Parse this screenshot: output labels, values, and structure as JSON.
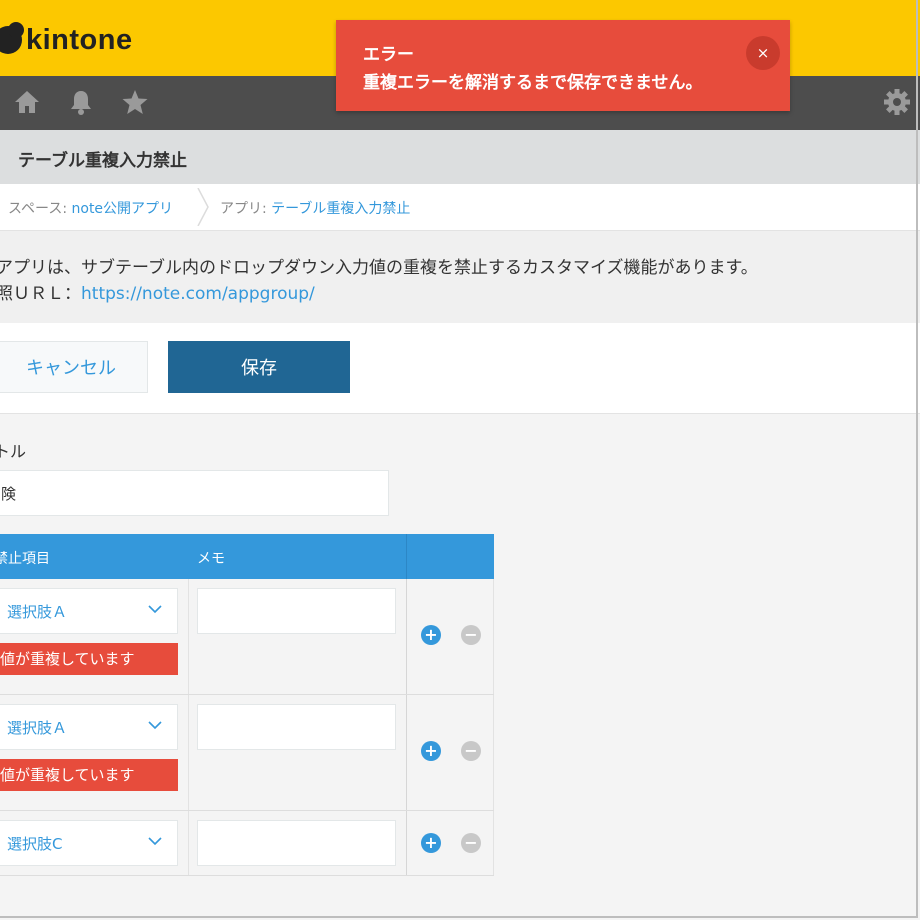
{
  "header": {
    "logo_text": "kintone"
  },
  "nav": {
    "icons": [
      "home-icon",
      "bell-icon",
      "star-icon",
      "gear-icon"
    ]
  },
  "toast": {
    "title": "エラー",
    "message": "重複エラーを解消するまで保存できません。",
    "close_glyph": "×"
  },
  "app": {
    "title": "テーブル重複入力禁止"
  },
  "breadcrumb": {
    "space_label": "スペース: ",
    "space_link": "note公開アプリ",
    "app_label": "アプリ: ",
    "app_link": "テーブル重複入力禁止"
  },
  "description": {
    "line1": "アプリは、サブテーブル内のドロップダウン入力値の重複を禁止するカスタマイズ機能があります。",
    "line2_label": "照ＵＲＬ：",
    "line2_link": "https://note.com/appgroup/"
  },
  "actions": {
    "cancel_label": "キャンセル",
    "save_label": "保存"
  },
  "form": {
    "title_label": "トル",
    "title_value": "険"
  },
  "table": {
    "headers": [
      "禁止項目",
      "メモ"
    ],
    "rows": [
      {
        "select": "選択肢Ａ",
        "error": "値が重複しています",
        "memo": ""
      },
      {
        "select": "選択肢Ａ",
        "error": "値が重複しています",
        "memo": ""
      },
      {
        "select": "選択肢C",
        "error": "",
        "memo": ""
      }
    ],
    "add_glyph": "+",
    "remove_glyph": "−"
  },
  "colors": {
    "header_yellow": "#fcc800",
    "nav_gray": "#4d4d4d",
    "accent_blue": "#3498db",
    "save_blue": "#206694",
    "error_red": "#e74c3c"
  }
}
